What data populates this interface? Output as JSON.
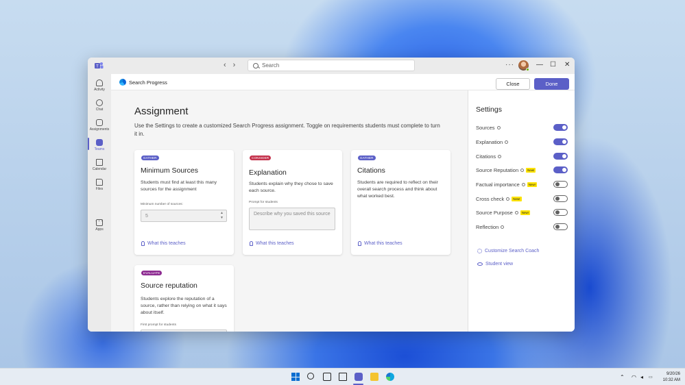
{
  "window": {
    "search_placeholder": "Search",
    "more_label": "···",
    "nav_back": "‹",
    "nav_forward": "›",
    "minimize": "—",
    "maximize": "☐",
    "close": "✕"
  },
  "rail": {
    "items": [
      {
        "label": "Activity",
        "icon": "bell-icon"
      },
      {
        "label": "Chat",
        "icon": "chat-icon"
      },
      {
        "label": "Assignments",
        "icon": "assignments-icon"
      },
      {
        "label": "Teams",
        "icon": "teams-icon"
      },
      {
        "label": "Calendar",
        "icon": "calendar-icon"
      },
      {
        "label": "Files",
        "icon": "file-icon"
      },
      {
        "label": "Apps",
        "icon": "apps-icon"
      }
    ],
    "more": "···"
  },
  "app": {
    "title": "Search Progress",
    "close_label": "Close",
    "done_label": "Done"
  },
  "assignment": {
    "heading": "Assignment",
    "description": "Use the Settings to create a customized Search Progress assignment. Toggle on requirements students must complete to turn it in.",
    "cards": [
      {
        "badge": "GATHER",
        "title": "Minimum Sources",
        "description": "Students must find at least this many sources for the assignment",
        "field_label": "Minimum number of sources:",
        "field_value": "5",
        "link": "What this teaches"
      },
      {
        "badge": "CONSIDER",
        "title": "Explanation",
        "description": "Students explain why they chose to save each source.",
        "field_label": "Prompt for students",
        "field_placeholder": "Describe why you saved this source",
        "link": "What this teaches"
      },
      {
        "badge": "GATHER",
        "title": "Citations",
        "description": "Students are required to reflect on their overall search process and think about what worked best.",
        "link": "What this teaches"
      },
      {
        "badge": "EVALUATE",
        "title": "Source reputation",
        "description": "Students explore the reputation of a source, rather than relying on what it says about itself.",
        "field_label": "First prompt for students"
      }
    ]
  },
  "settings": {
    "title": "Settings",
    "items": [
      {
        "label": "Sources",
        "new": false,
        "on": true
      },
      {
        "label": "Explanation",
        "new": false,
        "on": true
      },
      {
        "label": "Citations",
        "new": false,
        "on": true
      },
      {
        "label": "Source Reputation",
        "new": true,
        "on": true
      },
      {
        "label": "Factual importance",
        "new": true,
        "on": false
      },
      {
        "label": "Cross check",
        "new": true,
        "on": false
      },
      {
        "label": "Source Purpose",
        "new": true,
        "on": false
      },
      {
        "label": "Reflection",
        "new": false,
        "on": false
      }
    ],
    "new_label": "New!",
    "customize_link": "Customize Search Coach",
    "student_view_link": "Student view"
  },
  "taskbar": {
    "date": "9/20/26",
    "time": "10:32 AM",
    "tray_chevron": "⌃"
  },
  "colors": {
    "accent": "#5b5fc7",
    "consider": "#c4314b",
    "evaluate": "#8d2b91",
    "new_badge": "#fde300"
  }
}
